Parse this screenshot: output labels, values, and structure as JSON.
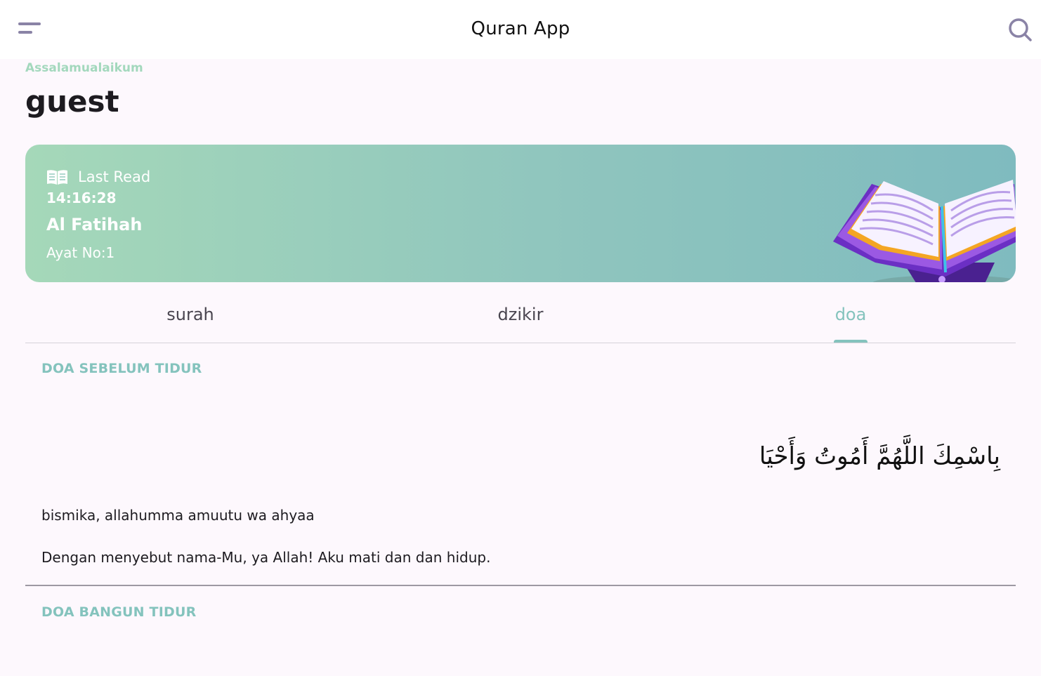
{
  "app_bar": {
    "title": "Quran App",
    "menu_icon": "menu-icon",
    "search_icon": "search-icon"
  },
  "greeting": {
    "salutation": "Assalamualaikum",
    "username": "guest"
  },
  "last_read": {
    "label": "Last Read",
    "icon": "open-book-icon",
    "time": "14:16:28",
    "surah": "Al Fatihah",
    "ayat": "Ayat No:1"
  },
  "tabs": [
    {
      "label": "surah",
      "active": false
    },
    {
      "label": "dzikir",
      "active": false
    },
    {
      "label": "doa",
      "active": true
    }
  ],
  "doa_list": [
    {
      "title": "DOA SEBELUM TIDUR",
      "arabic": "بِاسْمِكَ اللَّهُمَّ أَمُوتُ وَأَحْيَا",
      "latin": "bismika, allahumma amuutu wa ahyaa",
      "translation": "Dengan menyebut nama-Mu, ya Allah! Aku mati dan dan hidup."
    },
    {
      "title": "DOA BANGUN TIDUR"
    }
  ],
  "colors": {
    "accent": "#84c3bd",
    "greeting": "#a3d8bd",
    "card_gradient_start": "#a5d8b9",
    "card_gradient_end": "#7fbbbf",
    "background": "#fdf8fd"
  }
}
